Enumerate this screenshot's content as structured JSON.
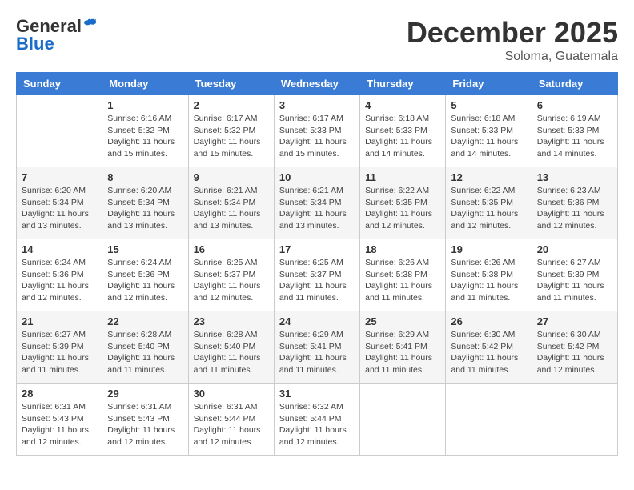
{
  "header": {
    "logo_line1": "General",
    "logo_line2": "Blue",
    "month_title": "December 2025",
    "location": "Soloma, Guatemala"
  },
  "weekdays": [
    "Sunday",
    "Monday",
    "Tuesday",
    "Wednesday",
    "Thursday",
    "Friday",
    "Saturday"
  ],
  "weeks": [
    [
      {
        "day": "",
        "detail": ""
      },
      {
        "day": "1",
        "detail": "Sunrise: 6:16 AM\nSunset: 5:32 PM\nDaylight: 11 hours and 15 minutes."
      },
      {
        "day": "2",
        "detail": "Sunrise: 6:17 AM\nSunset: 5:32 PM\nDaylight: 11 hours and 15 minutes."
      },
      {
        "day": "3",
        "detail": "Sunrise: 6:17 AM\nSunset: 5:33 PM\nDaylight: 11 hours and 15 minutes."
      },
      {
        "day": "4",
        "detail": "Sunrise: 6:18 AM\nSunset: 5:33 PM\nDaylight: 11 hours and 14 minutes."
      },
      {
        "day": "5",
        "detail": "Sunrise: 6:18 AM\nSunset: 5:33 PM\nDaylight: 11 hours and 14 minutes."
      },
      {
        "day": "6",
        "detail": "Sunrise: 6:19 AM\nSunset: 5:33 PM\nDaylight: 11 hours and 14 minutes."
      }
    ],
    [
      {
        "day": "7",
        "detail": "Sunrise: 6:20 AM\nSunset: 5:34 PM\nDaylight: 11 hours and 13 minutes."
      },
      {
        "day": "8",
        "detail": "Sunrise: 6:20 AM\nSunset: 5:34 PM\nDaylight: 11 hours and 13 minutes."
      },
      {
        "day": "9",
        "detail": "Sunrise: 6:21 AM\nSunset: 5:34 PM\nDaylight: 11 hours and 13 minutes."
      },
      {
        "day": "10",
        "detail": "Sunrise: 6:21 AM\nSunset: 5:34 PM\nDaylight: 11 hours and 13 minutes."
      },
      {
        "day": "11",
        "detail": "Sunrise: 6:22 AM\nSunset: 5:35 PM\nDaylight: 11 hours and 12 minutes."
      },
      {
        "day": "12",
        "detail": "Sunrise: 6:22 AM\nSunset: 5:35 PM\nDaylight: 11 hours and 12 minutes."
      },
      {
        "day": "13",
        "detail": "Sunrise: 6:23 AM\nSunset: 5:36 PM\nDaylight: 11 hours and 12 minutes."
      }
    ],
    [
      {
        "day": "14",
        "detail": "Sunrise: 6:24 AM\nSunset: 5:36 PM\nDaylight: 11 hours and 12 minutes."
      },
      {
        "day": "15",
        "detail": "Sunrise: 6:24 AM\nSunset: 5:36 PM\nDaylight: 11 hours and 12 minutes."
      },
      {
        "day": "16",
        "detail": "Sunrise: 6:25 AM\nSunset: 5:37 PM\nDaylight: 11 hours and 12 minutes."
      },
      {
        "day": "17",
        "detail": "Sunrise: 6:25 AM\nSunset: 5:37 PM\nDaylight: 11 hours and 11 minutes."
      },
      {
        "day": "18",
        "detail": "Sunrise: 6:26 AM\nSunset: 5:38 PM\nDaylight: 11 hours and 11 minutes."
      },
      {
        "day": "19",
        "detail": "Sunrise: 6:26 AM\nSunset: 5:38 PM\nDaylight: 11 hours and 11 minutes."
      },
      {
        "day": "20",
        "detail": "Sunrise: 6:27 AM\nSunset: 5:39 PM\nDaylight: 11 hours and 11 minutes."
      }
    ],
    [
      {
        "day": "21",
        "detail": "Sunrise: 6:27 AM\nSunset: 5:39 PM\nDaylight: 11 hours and 11 minutes."
      },
      {
        "day": "22",
        "detail": "Sunrise: 6:28 AM\nSunset: 5:40 PM\nDaylight: 11 hours and 11 minutes."
      },
      {
        "day": "23",
        "detail": "Sunrise: 6:28 AM\nSunset: 5:40 PM\nDaylight: 11 hours and 11 minutes."
      },
      {
        "day": "24",
        "detail": "Sunrise: 6:29 AM\nSunset: 5:41 PM\nDaylight: 11 hours and 11 minutes."
      },
      {
        "day": "25",
        "detail": "Sunrise: 6:29 AM\nSunset: 5:41 PM\nDaylight: 11 hours and 11 minutes."
      },
      {
        "day": "26",
        "detail": "Sunrise: 6:30 AM\nSunset: 5:42 PM\nDaylight: 11 hours and 11 minutes."
      },
      {
        "day": "27",
        "detail": "Sunrise: 6:30 AM\nSunset: 5:42 PM\nDaylight: 11 hours and 12 minutes."
      }
    ],
    [
      {
        "day": "28",
        "detail": "Sunrise: 6:31 AM\nSunset: 5:43 PM\nDaylight: 11 hours and 12 minutes."
      },
      {
        "day": "29",
        "detail": "Sunrise: 6:31 AM\nSunset: 5:43 PM\nDaylight: 11 hours and 12 minutes."
      },
      {
        "day": "30",
        "detail": "Sunrise: 6:31 AM\nSunset: 5:44 PM\nDaylight: 11 hours and 12 minutes."
      },
      {
        "day": "31",
        "detail": "Sunrise: 6:32 AM\nSunset: 5:44 PM\nDaylight: 11 hours and 12 minutes."
      },
      {
        "day": "",
        "detail": ""
      },
      {
        "day": "",
        "detail": ""
      },
      {
        "day": "",
        "detail": ""
      }
    ]
  ]
}
